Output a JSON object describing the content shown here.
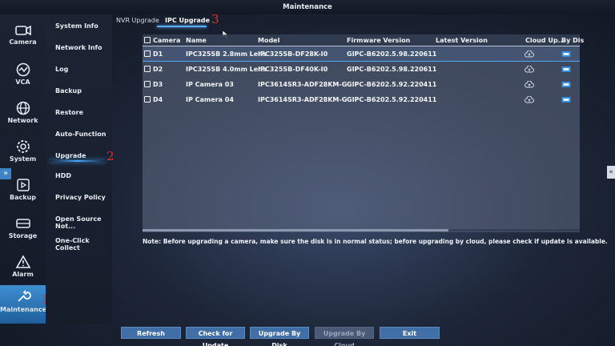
{
  "window": {
    "title": "Maintenance"
  },
  "nav": [
    {
      "label": "Camera",
      "icon": "camera-icon"
    },
    {
      "label": "VCA",
      "icon": "vca-icon"
    },
    {
      "label": "Network",
      "icon": "globe-icon"
    },
    {
      "label": "System",
      "icon": "gear-icon"
    },
    {
      "label": "Backup",
      "icon": "backup-icon"
    },
    {
      "label": "Storage",
      "icon": "storage-icon"
    },
    {
      "label": "Alarm",
      "icon": "warning-icon"
    },
    {
      "label": "Maintenance",
      "icon": "wrench-icon",
      "active": true
    }
  ],
  "submenu": [
    "System Info",
    "Network Info",
    "Log",
    "Backup",
    "Restore",
    "Auto-Function",
    "Upgrade",
    "HDD",
    "Privacy Policy",
    "Open Source Not...",
    "One-Click Collect"
  ],
  "annotations": {
    "mark1": "1",
    "mark2": "2",
    "mark3": "3"
  },
  "tabs": [
    {
      "label": "NVR Upgrade",
      "active": false
    },
    {
      "label": "IPC Upgrade",
      "active": true
    }
  ],
  "table": {
    "headers": {
      "camera": "Camera",
      "name": "Name",
      "model": "Model",
      "firmware": "Firmware Version",
      "latest": "Latest Version",
      "cloud": "Cloud Up...",
      "disk": "By Dis"
    },
    "rows": [
      {
        "camera": "D1",
        "name": "IPC325SB 2.8mm Lens",
        "model": "IPC325SB-DF28K-I0",
        "firmware": "GIPC-B6202.5.98.220611",
        "latest": ""
      },
      {
        "camera": "D2",
        "name": "IPC325SB 4.0mm Lens",
        "model": "IPC325SB-DF40K-I0",
        "firmware": "GIPC-B6202.5.98.220611",
        "latest": ""
      },
      {
        "camera": "D3",
        "name": "IP Camera 03",
        "model": "IPC3614SR3-ADF28KM-G",
        "firmware": "GIPC-B6202.5.92.220411",
        "latest": ""
      },
      {
        "camera": "D4",
        "name": "IP Camera 04",
        "model": "IPC3614SR3-ADF28KM-G",
        "firmware": "GIPC-B6202.5.92.220411",
        "latest": ""
      }
    ]
  },
  "note": "Note: Before upgrading a camera, make sure the disk is in normal status; before upgrading by cloud, please check if update is available.",
  "buttons": {
    "refresh": "Refresh",
    "check": "Check for Update",
    "by_disk": "Upgrade By Disk",
    "by_cloud": "Upgrade By Cloud",
    "exit": "Exit"
  },
  "colors": {
    "accent": "#3d8fd0",
    "mark": "#e03030"
  }
}
